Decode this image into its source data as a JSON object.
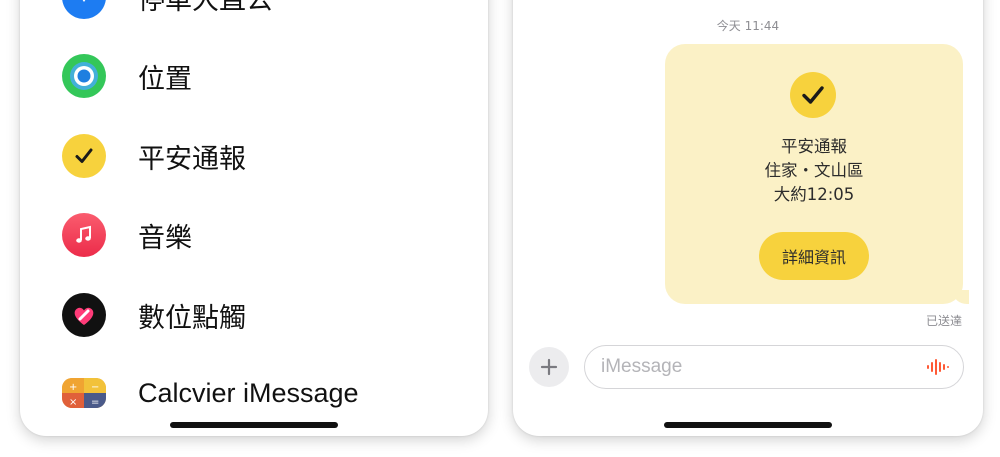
{
  "left_menu": {
    "items": [
      {
        "label": "停車大直公",
        "icon": "parking-icon",
        "color": "#1d7cf2"
      },
      {
        "label": "位置",
        "icon": "location-icon",
        "color": "#34c759"
      },
      {
        "label": "平安通報",
        "icon": "check-in-icon",
        "color": "#f7d23d"
      },
      {
        "label": "音樂",
        "icon": "music-icon",
        "color": "#f33a53"
      },
      {
        "label": "數位點觸",
        "icon": "digital-touch-icon",
        "color": "#111111"
      },
      {
        "label": "Calcvier iMessage",
        "icon": "calculator-icon",
        "color": "#f0a432"
      }
    ]
  },
  "chat": {
    "timestamp": "今天 11:44",
    "check_in": {
      "title": "平安通報",
      "location": "住家・文山區",
      "eta": "大約12:05",
      "button_label": "詳細資訊",
      "accent": "#f7d23d",
      "bubble_color": "#fbf1c6"
    },
    "delivered": "已送達",
    "input_placeholder": "iMessage"
  }
}
